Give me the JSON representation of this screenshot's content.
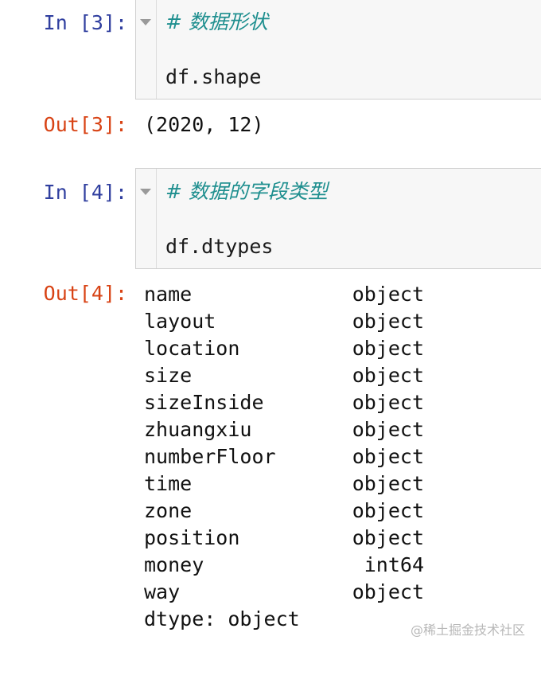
{
  "cells": [
    {
      "in_prompt": "In [3]:",
      "comment": "# 数据形状",
      "code": "df.shape",
      "out_prompt": "Out[3]:",
      "output": "(2020, 12)"
    },
    {
      "in_prompt": "In [4]:",
      "comment": "# 数据的字段类型",
      "code": "df.dtypes",
      "out_prompt": "Out[4]:",
      "dtypes": [
        {
          "name": "name",
          "type": "object"
        },
        {
          "name": "layout",
          "type": "object"
        },
        {
          "name": "location",
          "type": "object"
        },
        {
          "name": "size",
          "type": "object"
        },
        {
          "name": "sizeInside",
          "type": "object"
        },
        {
          "name": "zhuangxiu",
          "type": "object"
        },
        {
          "name": "numberFloor",
          "type": "object"
        },
        {
          "name": "time",
          "type": "object"
        },
        {
          "name": "zone",
          "type": "object"
        },
        {
          "name": "position",
          "type": "object"
        },
        {
          "name": "money",
          "type": "int64"
        },
        {
          "name": "way",
          "type": "object"
        }
      ],
      "dtype_footer": "dtype: object"
    }
  ],
  "watermark": "@稀土掘金技术社区"
}
